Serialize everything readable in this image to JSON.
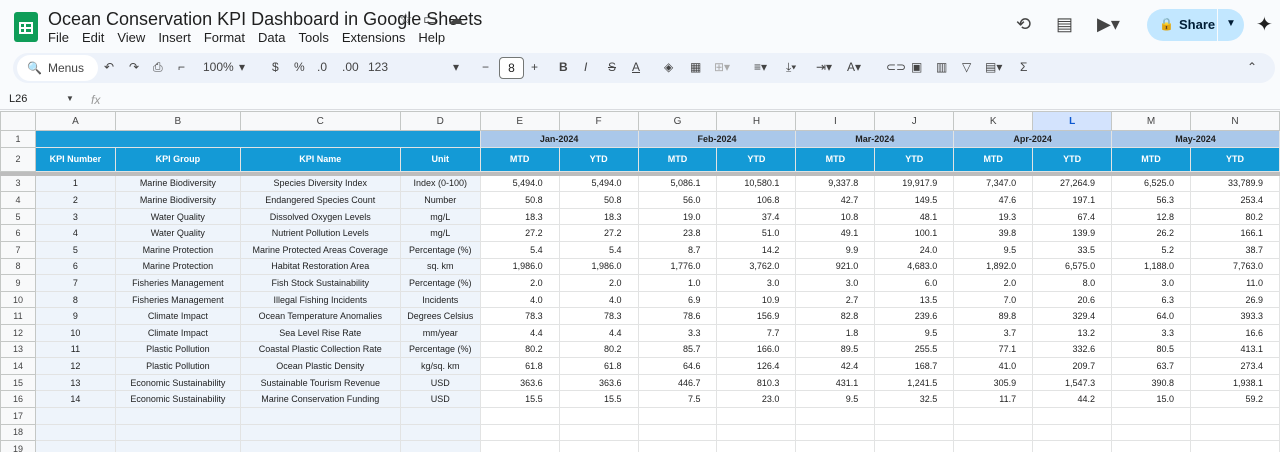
{
  "app": {
    "doc_title": "Ocean Conservation KPI Dashboard in Google Sheets",
    "menu": [
      "File",
      "Edit",
      "View",
      "Insert",
      "Format",
      "Data",
      "Tools",
      "Extensions",
      "Help"
    ],
    "share_label": "Share",
    "brand_color": "#0f9d58",
    "share_color": "#c2e7ff"
  },
  "toolbar": {
    "search_placeholder": "Menus",
    "zoom": "100%",
    "currency": "$",
    "percent": "%",
    "dec_decrease": ".0",
    "dec_increase": ".00",
    "number_format": "123",
    "font_size": "8",
    "minus": "−",
    "plus": "+",
    "bold": "B",
    "italic": "I",
    "text_color": "A",
    "sum": "Σ"
  },
  "formula_bar": {
    "cell_ref": "L26",
    "fx": "fx"
  },
  "sheet": {
    "columns": [
      "A",
      "B",
      "C",
      "D",
      "E",
      "F",
      "G",
      "H",
      "I",
      "J",
      "K",
      "L",
      "M",
      "N"
    ],
    "selected_column": "L",
    "months": [
      "Jan-2024",
      "Feb-2024",
      "Mar-2024",
      "Apr-2024",
      "May-2024"
    ],
    "headers": [
      "KPI Number",
      "KPI Group",
      "KPI Name",
      "Unit"
    ],
    "mtd": "MTD",
    "ytd": "YTD",
    "row_numbers": [
      "1",
      "2",
      "3",
      "4",
      "5",
      "6",
      "7",
      "8",
      "9",
      "10",
      "11",
      "12",
      "13",
      "14",
      "15",
      "16",
      "17",
      "18",
      "19"
    ],
    "rows": [
      {
        "num": "1",
        "group": "Marine Biodiversity",
        "name": "Species Diversity Index",
        "unit": "Index (0-100)",
        "vals": [
          "5,494.0",
          "5,494.0",
          "5,086.1",
          "10,580.1",
          "9,337.8",
          "19,917.9",
          "7,347.0",
          "27,264.9",
          "6,525.0",
          "33,789.9"
        ]
      },
      {
        "num": "2",
        "group": "Marine Biodiversity",
        "name": "Endangered Species Count",
        "unit": "Number",
        "vals": [
          "50.8",
          "50.8",
          "56.0",
          "106.8",
          "42.7",
          "149.5",
          "47.6",
          "197.1",
          "56.3",
          "253.4"
        ]
      },
      {
        "num": "3",
        "group": "Water Quality",
        "name": "Dissolved Oxygen Levels",
        "unit": "mg/L",
        "vals": [
          "18.3",
          "18.3",
          "19.0",
          "37.4",
          "10.8",
          "48.1",
          "19.3",
          "67.4",
          "12.8",
          "80.2"
        ]
      },
      {
        "num": "4",
        "group": "Water Quality",
        "name": "Nutrient Pollution Levels",
        "unit": "mg/L",
        "vals": [
          "27.2",
          "27.2",
          "23.8",
          "51.0",
          "49.1",
          "100.1",
          "39.8",
          "139.9",
          "26.2",
          "166.1"
        ]
      },
      {
        "num": "5",
        "group": "Marine Protection",
        "name": "Marine Protected Areas Coverage",
        "unit": "Percentage (%)",
        "vals": [
          "5.4",
          "5.4",
          "8.7",
          "14.2",
          "9.9",
          "24.0",
          "9.5",
          "33.5",
          "5.2",
          "38.7"
        ]
      },
      {
        "num": "6",
        "group": "Marine Protection",
        "name": "Habitat Restoration Area",
        "unit": "sq. km",
        "vals": [
          "1,986.0",
          "1,986.0",
          "1,776.0",
          "3,762.0",
          "921.0",
          "4,683.0",
          "1,892.0",
          "6,575.0",
          "1,188.0",
          "7,763.0"
        ]
      },
      {
        "num": "7",
        "group": "Fisheries Management",
        "name": "Fish Stock Sustainability",
        "unit": "Percentage (%)",
        "vals": [
          "2.0",
          "2.0",
          "1.0",
          "3.0",
          "3.0",
          "6.0",
          "2.0",
          "8.0",
          "3.0",
          "11.0"
        ]
      },
      {
        "num": "8",
        "group": "Fisheries Management",
        "name": "Illegal Fishing Incidents",
        "unit": "Incidents",
        "vals": [
          "4.0",
          "4.0",
          "6.9",
          "10.9",
          "2.7",
          "13.5",
          "7.0",
          "20.6",
          "6.3",
          "26.9"
        ]
      },
      {
        "num": "9",
        "group": "Climate Impact",
        "name": "Ocean Temperature Anomalies",
        "unit": "Degrees Celsius",
        "vals": [
          "78.3",
          "78.3",
          "78.6",
          "156.9",
          "82.8",
          "239.6",
          "89.8",
          "329.4",
          "64.0",
          "393.3"
        ]
      },
      {
        "num": "10",
        "group": "Climate Impact",
        "name": "Sea Level Rise Rate",
        "unit": "mm/year",
        "vals": [
          "4.4",
          "4.4",
          "3.3",
          "7.7",
          "1.8",
          "9.5",
          "3.7",
          "13.2",
          "3.3",
          "16.6"
        ]
      },
      {
        "num": "11",
        "group": "Plastic Pollution",
        "name": "Coastal Plastic Collection Rate",
        "unit": "Percentage (%)",
        "vals": [
          "80.2",
          "80.2",
          "85.7",
          "166.0",
          "89.5",
          "255.5",
          "77.1",
          "332.6",
          "80.5",
          "413.1"
        ]
      },
      {
        "num": "12",
        "group": "Plastic Pollution",
        "name": "Ocean Plastic Density",
        "unit": "kg/sq. km",
        "vals": [
          "61.8",
          "61.8",
          "64.6",
          "126.4",
          "42.4",
          "168.7",
          "41.0",
          "209.7",
          "63.7",
          "273.4"
        ]
      },
      {
        "num": "13",
        "group": "Economic Sustainability",
        "name": "Sustainable Tourism Revenue",
        "unit": "USD",
        "vals": [
          "363.6",
          "363.6",
          "446.7",
          "810.3",
          "431.1",
          "1,241.5",
          "305.9",
          "1,547.3",
          "390.8",
          "1,938.1"
        ]
      },
      {
        "num": "14",
        "group": "Economic Sustainability",
        "name": "Marine Conservation Funding",
        "unit": "USD",
        "vals": [
          "15.5",
          "15.5",
          "7.5",
          "23.0",
          "9.5",
          "32.5",
          "11.7",
          "44.2",
          "15.0",
          "59.2"
        ]
      }
    ]
  }
}
